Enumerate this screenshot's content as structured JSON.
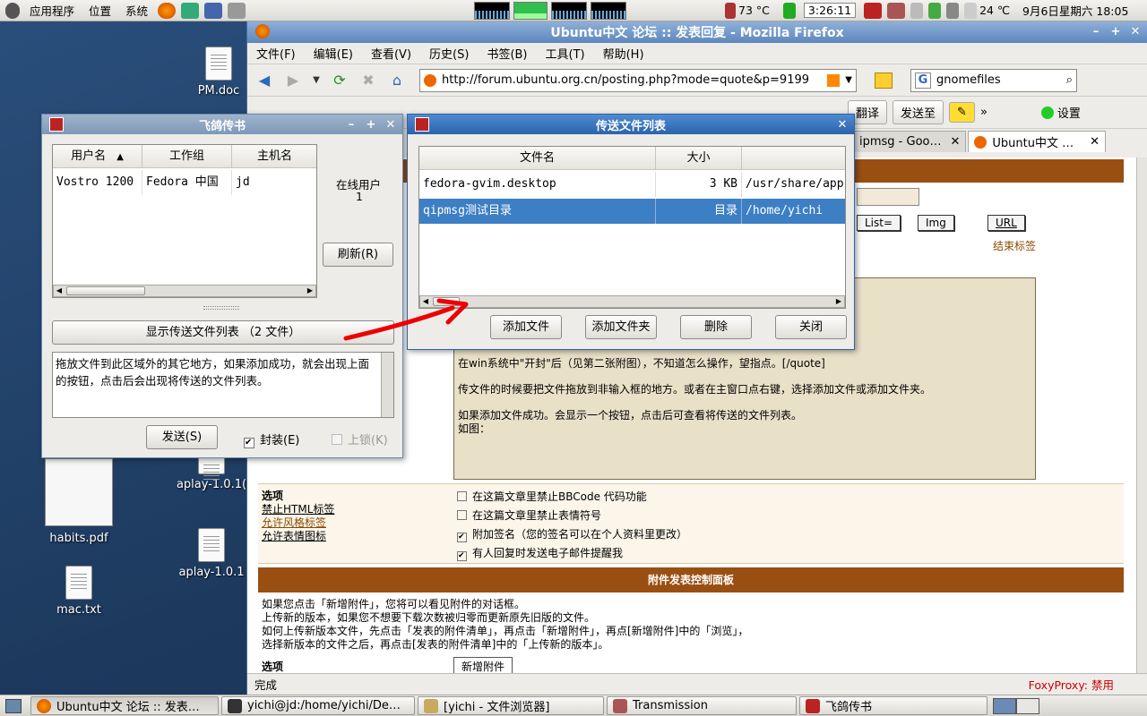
{
  "top_panel": {
    "menus": [
      "应用程序",
      "位置",
      "系统"
    ],
    "temperature": "73 °C",
    "clock": "3:26:11",
    "weather": "24 ℃",
    "date_time": "9月6日星期六 18:05"
  },
  "desktop": {
    "icons": [
      "PM.doc",
      "habits.pdf",
      "mac.txt",
      "aplay-1.0.1(",
      "aplay-1.0.1"
    ]
  },
  "firefox": {
    "title": "Ubuntu中文 论坛 :: 发表回复 - Mozilla Firefox",
    "menu": [
      "文件(F)",
      "编辑(E)",
      "查看(V)",
      "历史(S)",
      "书签(B)",
      "工具(T)",
      "帮助(H)"
    ],
    "url": "http://forum.ubuntu.org.cn/posting.php?mode=quote&p=9199",
    "search_value": "gnomefiles",
    "toolbar": {
      "translate": "翻译",
      "send_to": "发送至",
      "settings": "设置"
    },
    "tabs": [
      "ipmsg - Goo…",
      "Ubuntu中文 …"
    ],
    "status": "完成",
    "foxyproxy": "FoxyProxy: 禁用"
  },
  "forum": {
    "bb_buttons": [
      "List=",
      "Img",
      "URL"
    ],
    "close_tags": "结束标签",
    "post_lines": [
      "在win系统中\"开封\"后（见第二张附图），不知道怎么操作，望指点。[/quote]",
      "传文件的时候要把文件拖放到非输入框的地方。或者在主窗口点右键，选择添加文件或添加文件夹。",
      "如果添加文件成功。会显示一个按钮，点击后可查看将传送的文件列表。",
      "如图："
    ],
    "options_title": "选项",
    "option_links": [
      "禁止HTML标签",
      "允许风格标签",
      "允许表情图标"
    ],
    "checkboxes": [
      {
        "label": "在这篇文章里禁止BBCode 代码功能",
        "checked": false
      },
      {
        "label": "在这篇文章里禁止表情符号",
        "checked": false
      },
      {
        "label": "附加签名（您的签名可以在个人资料里更改）",
        "checked": true
      },
      {
        "label": "有人回复时发送电子邮件提醒我",
        "checked": true
      }
    ],
    "attach_title": "附件发表控制面板",
    "attach_lines": [
      "如果您点击「新增附件」，您将可以看见附件的对话框。",
      "上传新的版本，如果您不想要下载次数被归零而更新原先旧版的文件。",
      "如何上传新版本文件，先点击「发表的附件清单」，再点击「新增附件」，再点[新增附件]中的「浏览」，",
      "选择新版本的文件之后，再点击[发表的附件清单]中的「上传新的版本」。"
    ],
    "options_title2": "选项",
    "add_attachment": "新增附件"
  },
  "ipmsg": {
    "title": "飞鸽传书",
    "columns": [
      "用户名",
      "工作组",
      "主机名"
    ],
    "rows": [
      [
        "Vostro 1200",
        "Fedora 中国",
        "jd"
      ]
    ],
    "online_label": "在线用户",
    "online_count": "1",
    "refresh": "刷新(R)",
    "show_files": "显示传送文件列表 （2 文件）",
    "message": "拖放文件到此区域外的其它地方，如果添加成功，就会出现上面的按钮，点击后会出现将传送的文件列表。",
    "send": "发送(S)",
    "seal": "封装(E)",
    "lock": "上锁(K)"
  },
  "file_list": {
    "title": "传送文件列表",
    "columns": [
      "文件名",
      "大小"
    ],
    "rows": [
      [
        "fedora-gvim.desktop",
        "3 KB",
        "/usr/share/app"
      ],
      [
        "qipmsg测试目录",
        "目录",
        "/home/yichi"
      ]
    ],
    "buttons": [
      "添加文件",
      "添加文件夹",
      "删除",
      "关闭"
    ]
  },
  "taskbar": [
    "Ubuntu中文 论坛 :: 发表…",
    "yichi@jd:/home/yichi/De…",
    "[yichi - 文件浏览器]",
    "Transmission",
    "飞鸽传书"
  ]
}
